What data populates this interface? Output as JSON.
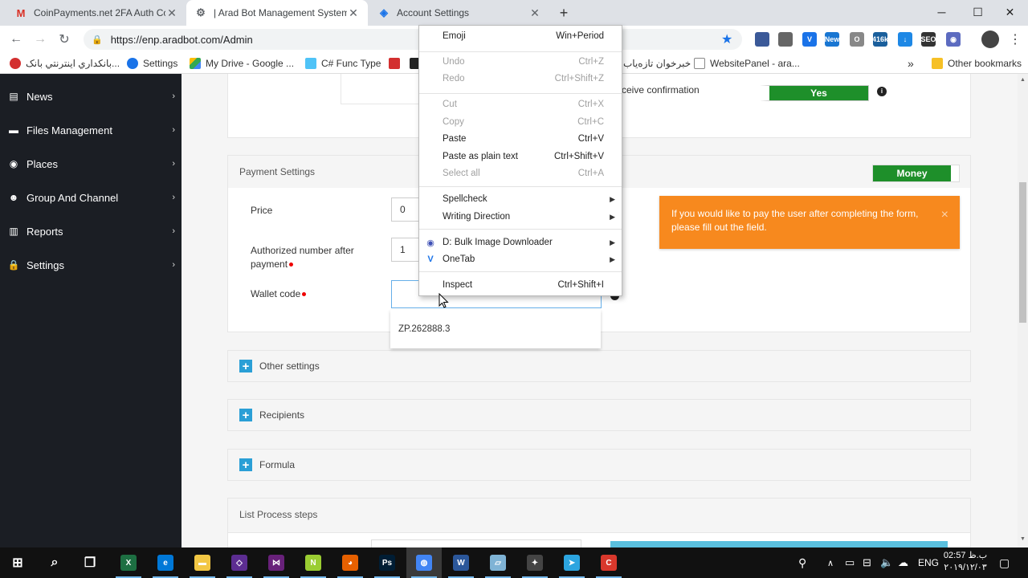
{
  "tabs": [
    {
      "favicon": "gmail-icon",
      "title": "CoinPayments.net 2FA Auth Code",
      "active": false
    },
    {
      "favicon": "bot-icon",
      "title": "| Arad Bot Management System",
      "active": true
    },
    {
      "favicon": "globe-icon",
      "title": "Account Settings",
      "active": false
    }
  ],
  "new_tab": "+",
  "window_controls": {
    "minimize": "─",
    "maximize": "☐",
    "close": "✕"
  },
  "toolbar": {
    "back": "←",
    "forward": "→",
    "reload": "↻",
    "url": "https://enp.aradbot.com/Admin",
    "lock": "🔒",
    "star": "★",
    "menu": "⋮"
  },
  "extensions": [
    {
      "name": "book-ext-icon",
      "color": "#3b5998",
      "text": ""
    },
    {
      "name": "pen-ext-icon",
      "color": "#666",
      "text": ""
    },
    {
      "name": "onetab-ext-icon",
      "color": "#1a73e8",
      "text": "V"
    },
    {
      "name": "news-ext-icon",
      "color": "#1976d2",
      "text": "New"
    },
    {
      "name": "circle-ext-icon",
      "color": "#888",
      "text": "O"
    },
    {
      "name": "lock-ext-icon",
      "color": "#1a5f9c",
      "text": "416k"
    },
    {
      "name": "download-ext-icon",
      "color": "#1e88e5",
      "text": "↓"
    },
    {
      "name": "seo-ext-icon",
      "color": "#333",
      "text": "SEO"
    },
    {
      "name": "target-ext-icon",
      "color": "#5c6bc0",
      "text": "◉"
    }
  ],
  "bookmarks": [
    {
      "label": "بانکداري اينترنتي بانک...",
      "color": "#d32f2f"
    },
    {
      "label": "Settings",
      "color": "#1a73e8"
    },
    {
      "label": "My Drive - Google ...",
      "color": "#fbbc04"
    },
    {
      "label": "C# Func Type",
      "color": "#4fc3f7"
    },
    {
      "label": "",
      "color": "#d32f2f"
    },
    {
      "label": "",
      "color": "#222"
    },
    {
      "label": "خبرخوان تازه‌یاب",
      "color": "#ffffff"
    },
    {
      "label": "WebsitePanel - ara...",
      "color": "#ffffff"
    }
  ],
  "bookmarks_more": "»",
  "other_bookmarks": "Other bookmarks",
  "sidebar": {
    "items": [
      {
        "icon": "news-icon",
        "glyph": "▤",
        "label": "News"
      },
      {
        "icon": "folder-icon",
        "glyph": "▬",
        "label": "Files Management"
      },
      {
        "icon": "map-pin-icon",
        "glyph": "◉",
        "label": "Places"
      },
      {
        "icon": "group-icon",
        "glyph": "☻",
        "label": "Group And Channel"
      },
      {
        "icon": "chart-icon",
        "glyph": "▥",
        "label": "Reports"
      },
      {
        "icon": "lock-icon",
        "glyph": "🔒",
        "label": "Settings"
      }
    ],
    "arrow": "›"
  },
  "form": {
    "receive_confirmation_label": "ceive confirmation",
    "receive_confirmation_toggle": "Yes",
    "info_glyph": "i",
    "payment_settings_title": "Payment Settings",
    "money_toggle": "Money",
    "price_label": "Price",
    "price_value": "0",
    "authorized_label": "Authorized number after payment",
    "authorized_value": "1",
    "wallet_label": "Wallet code",
    "wallet_value": "",
    "alert_text": "If you would like to pay the user after completing the form, please fill out the field.",
    "alert_close": "×",
    "autocomplete_suggestion": "ZP.262888.3",
    "other_settings": "Other settings",
    "recipients": "Recipients",
    "formula": "Formula",
    "list_process_steps": "List Process steps",
    "plus_glyph": "+"
  },
  "context_menu": {
    "emoji": {
      "label": "Emoji",
      "shortcut": "Win+Period"
    },
    "undo": {
      "label": "Undo",
      "shortcut": "Ctrl+Z"
    },
    "redo": {
      "label": "Redo",
      "shortcut": "Ctrl+Shift+Z"
    },
    "cut": {
      "label": "Cut",
      "shortcut": "Ctrl+X"
    },
    "copy": {
      "label": "Copy",
      "shortcut": "Ctrl+C"
    },
    "paste": {
      "label": "Paste",
      "shortcut": "Ctrl+V"
    },
    "paste_plain": {
      "label": "Paste as plain text",
      "shortcut": "Ctrl+Shift+V"
    },
    "select_all": {
      "label": "Select all",
      "shortcut": "Ctrl+A"
    },
    "spellcheck": {
      "label": "Spellcheck"
    },
    "writing_direction": {
      "label": "Writing Direction"
    },
    "bulk_image": {
      "label": "D: Bulk Image Downloader"
    },
    "onetab": {
      "label": "OneTab"
    },
    "inspect": {
      "label": "Inspect",
      "shortcut": "Ctrl+Shift+I"
    },
    "submenu_arrow": "▶"
  },
  "taskbar": {
    "apps": [
      {
        "name": "windows-start-icon",
        "color": "#111",
        "text": "⊞"
      },
      {
        "name": "search-icon",
        "color": "#111",
        "text": "⌕"
      },
      {
        "name": "task-view-icon",
        "color": "#111",
        "text": "❐"
      },
      {
        "name": "excel-icon",
        "color": "#1d6f42",
        "text": "X"
      },
      {
        "name": "edge-icon",
        "color": "#0078d7",
        "text": "e"
      },
      {
        "name": "file-explorer-icon",
        "color": "#f2c744",
        "text": "▬"
      },
      {
        "name": "visual-studio-code-icon",
        "color": "#5c2d91",
        "text": "◇"
      },
      {
        "name": "visual-studio-icon",
        "color": "#68217a",
        "text": "⋈"
      },
      {
        "name": "notepad-plus-icon",
        "color": "#9acd32",
        "text": "N"
      },
      {
        "name": "firefox-icon",
        "color": "#e66000",
        "text": "◕"
      },
      {
        "name": "photoshop-icon",
        "color": "#001d34",
        "text": "Ps"
      },
      {
        "name": "chrome-icon",
        "color": "#4285f4",
        "text": "◍"
      },
      {
        "name": "word-icon",
        "color": "#2b579a",
        "text": "W"
      },
      {
        "name": "notepad-icon",
        "color": "#7fb3d5",
        "text": "▱"
      },
      {
        "name": "tool-icon",
        "color": "#444",
        "text": "✦"
      },
      {
        "name": "telegram-icon",
        "color": "#2ca5e0",
        "text": "➤"
      },
      {
        "name": "red-app-icon",
        "color": "#d9382c",
        "text": "C"
      }
    ],
    "tray": {
      "language": "ENG",
      "time": "02:57 ب.ظ",
      "date": "۲۰۱۹/۱۲/۰۳"
    }
  }
}
